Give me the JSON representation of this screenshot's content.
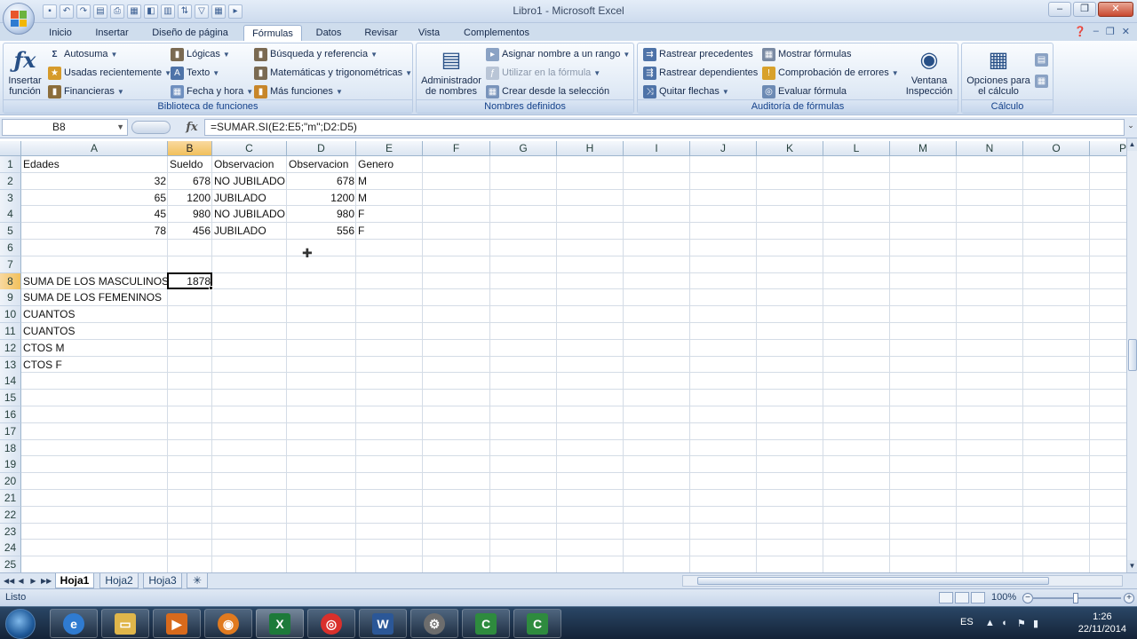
{
  "window": {
    "title": "Libro1 - Microsoft Excel",
    "controls": [
      "–",
      "❐",
      "✕"
    ]
  },
  "colors": {
    "accent": "#15428b",
    "selection": "#f1c05c",
    "excel_green": "#1d7a3a"
  },
  "tabs": [
    {
      "label": "Inicio"
    },
    {
      "label": "Insertar"
    },
    {
      "label": "Diseño de página"
    },
    {
      "label": "Fórmulas"
    },
    {
      "label": "Datos"
    },
    {
      "label": "Revisar"
    },
    {
      "label": "Vista"
    },
    {
      "label": "Complementos"
    }
  ],
  "active_tab": "Fórmulas",
  "ribbon": {
    "biblioteca": {
      "label": "Biblioteca de funciones",
      "insertar_funcion": "Insertar función",
      "items": [
        "Autosuma",
        "Usadas recientemente",
        "Financieras",
        "Lógicas",
        "Texto",
        "Fecha y hora",
        "Búsqueda y referencia",
        "Matemáticas y trigonométricas",
        "Más funciones"
      ]
    },
    "nombres": {
      "label": "Nombres definidos",
      "administrador": "Administrador de nombres",
      "items": [
        "Asignar nombre a un rango",
        "Utilizar en la fórmula",
        "Crear desde la selección"
      ]
    },
    "auditoria": {
      "label": "Auditoría de fórmulas",
      "items": [
        "Rastrear precedentes",
        "Rastrear dependientes",
        "Quitar flechas",
        "Mostrar fórmulas",
        "Comprobación de errores",
        "Evaluar fórmula"
      ],
      "ventana": "Ventana Inspección"
    },
    "calculo": {
      "label": "Cálculo",
      "opciones": "Opciones para el cálculo"
    }
  },
  "formula_bar": {
    "name_box": "B8",
    "formula": "=SUMAR.SI(E2:E5;\"m\";D2:D5)"
  },
  "grid": {
    "columns": [
      "A",
      "B",
      "C",
      "D",
      "E",
      "F",
      "G",
      "H",
      "I",
      "J",
      "K",
      "L",
      "M",
      "N",
      "O",
      "P"
    ],
    "rows": [
      "1",
      "2",
      "3",
      "4",
      "5",
      "6",
      "7",
      "8",
      "9",
      "10",
      "11",
      "12",
      "13",
      "14",
      "15",
      "16",
      "17",
      "18",
      "19",
      "20",
      "21",
      "22",
      "23",
      "24",
      "25"
    ],
    "selected_cell": "B8",
    "header_row": [
      "Edades",
      "Sueldo",
      "Observacion",
      "Observacion",
      "Genero"
    ],
    "data_rows": [
      [
        "32",
        "678",
        "NO JUBILADO",
        "678",
        "M"
      ],
      [
        "65",
        "1200",
        "JUBILADO",
        "1200",
        "M"
      ],
      [
        "45",
        "980",
        "NO JUBILADO",
        "980",
        "F"
      ],
      [
        "78",
        "456",
        "JUBILADO",
        "556",
        "F"
      ]
    ],
    "labels": [
      "SUMA DE LOS MASCULINOS",
      "SUMA DE LOS FEMENINOS",
      "CUANTOS",
      "CUANTOS",
      "CTOS M",
      "CTOS F"
    ],
    "result_b8": "1878"
  },
  "sheets": [
    "Hoja1",
    "Hoja2",
    "Hoja3"
  ],
  "active_sheet": "Hoja1",
  "status": {
    "text": "Listo",
    "zoom": "100%"
  },
  "taskbar": {
    "language": "ES",
    "time": "1:26",
    "date": "22/11/2014"
  }
}
